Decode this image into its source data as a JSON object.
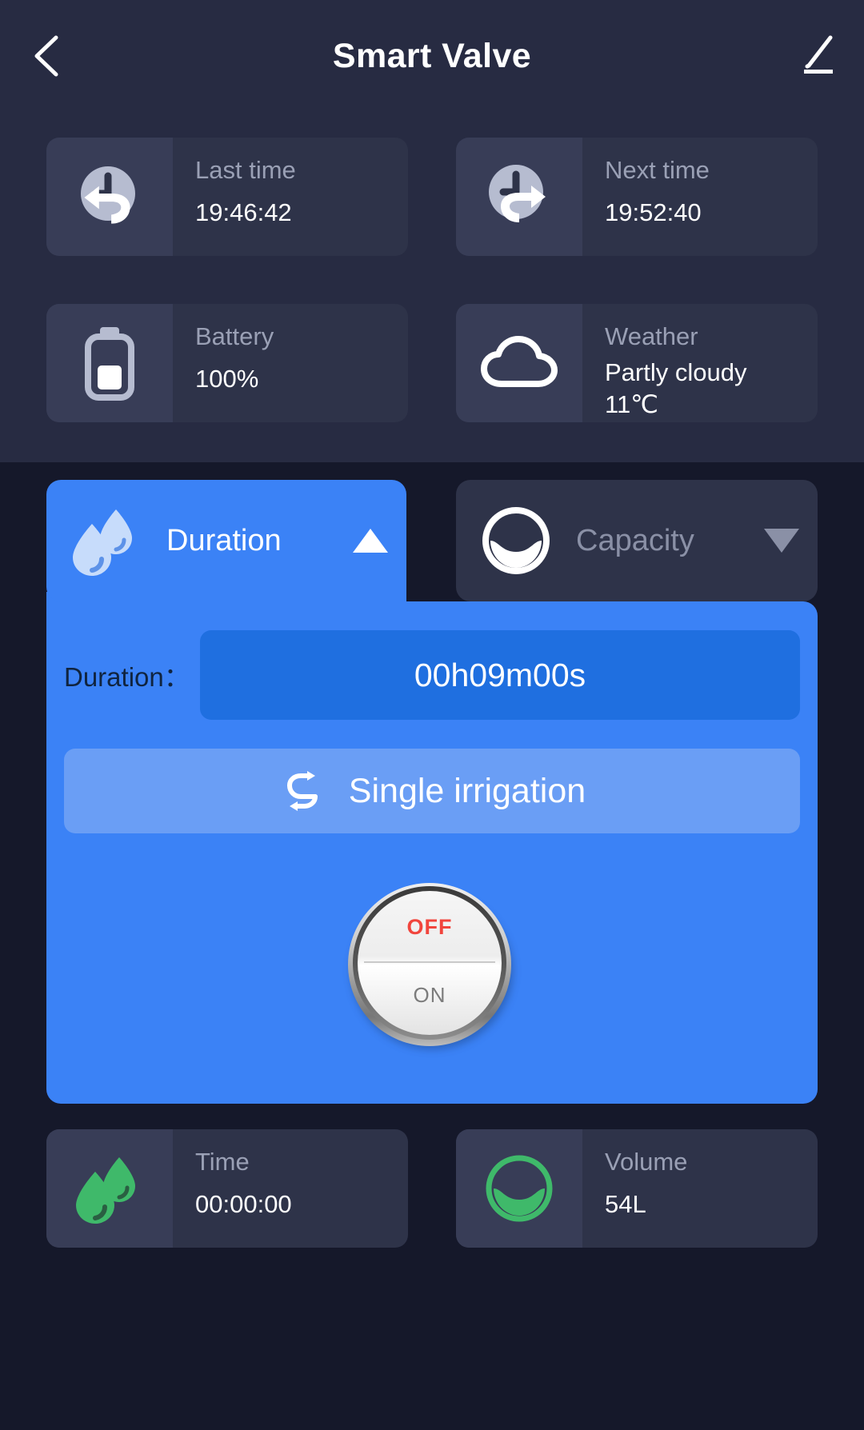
{
  "header": {
    "title": "Smart Valve",
    "back_icon": "chevron-left-icon",
    "edit_icon": "pencil-icon"
  },
  "info_cards": [
    {
      "icon": "clock-back-icon",
      "label": "Last time",
      "value": "19:46:42"
    },
    {
      "icon": "clock-forward-icon",
      "label": "Next time",
      "value": "19:52:40"
    },
    {
      "icon": "battery-icon",
      "label": "Battery",
      "value": "100%"
    },
    {
      "icon": "cloud-icon",
      "label": "Weather",
      "value": "Partly cloudy",
      "value2": "11℃"
    }
  ],
  "tabs": [
    {
      "label": "Duration",
      "icon": "water-drops-icon",
      "arrow": "triangle-up-icon",
      "active": true
    },
    {
      "label": "Capacity",
      "icon": "water-level-circle-icon",
      "arrow": "triangle-down-icon",
      "active": false
    }
  ],
  "panel": {
    "duration_label": "Duration：",
    "duration_value": "00h09m00s",
    "irrigation_label": "Single irrigation",
    "irrigation_icon": "repeat-loop-icon",
    "toggle": {
      "off_label": "OFF",
      "on_label": "ON",
      "state": "OFF"
    }
  },
  "bottom_cards": [
    {
      "icon": "green-water-drops-icon",
      "label": "Time",
      "value": "00:00:00"
    },
    {
      "icon": "green-water-level-circle-icon",
      "label": "Volume",
      "value": "54L"
    }
  ],
  "colors": {
    "background": "#15182a",
    "top_region": "#272b42",
    "card": "#2e3349",
    "card_icon": "#383d57",
    "accent_blue": "#3b82f6",
    "accent_blue_dark": "#1f6fe0",
    "accent_blue_light": "#6a9ef5",
    "green": "#3fb96a",
    "muted_text": "#9aa0b5",
    "off_red": "#f1453d"
  }
}
